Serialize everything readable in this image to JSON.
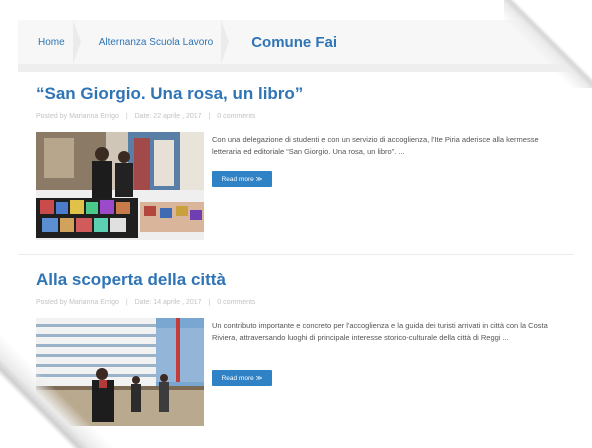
{
  "breadcrumb": {
    "home": "Home",
    "parent": "Alternanza Scuola Lavoro",
    "current": "Comune Fai"
  },
  "posts": [
    {
      "title": "“San Giorgio. Una rosa, un libro”",
      "author": "Posted by Marianna Errigo",
      "date": "Date: 22 aprile , 2017",
      "comments": "0 comments",
      "excerpt": "Con una delegazione di studenti e con un servizio di accoglienza, l'Ite Piria aderisce alla kermesse letteraria ed editoriale “San Giorgio. Una rosa, un libro”. ...",
      "read_more": "Read more ≫",
      "image": "book-fair-photo"
    },
    {
      "title": "Alla scoperta della città",
      "author": "Posted by Marianna Errigo",
      "date": "Date: 14 aprile , 2017",
      "comments": "0 comments",
      "excerpt": "Un contributo importante e concreto per l'accoglienza e la guida dei turisti arrivati in città con la Costa Riviera, attraversando luoghi di principale interesse storico-culturale della città di Reggi ...",
      "read_more": "Read more ≫",
      "image": "cruise-ship-photo"
    }
  ]
}
